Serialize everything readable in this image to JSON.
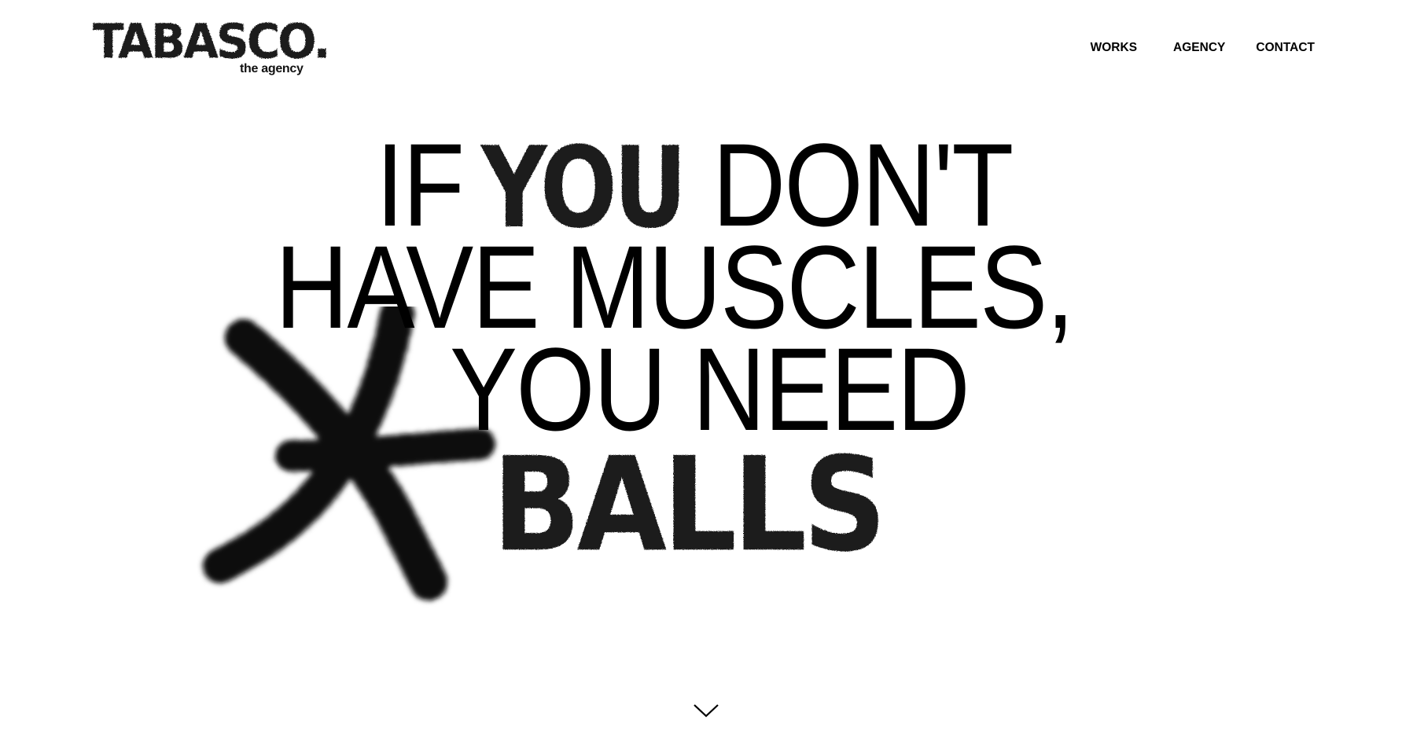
{
  "brand": {
    "name": "TABASCO.",
    "tagline": "the agency"
  },
  "nav": {
    "items": [
      {
        "label": "WORKS"
      },
      {
        "label": "AGENCY"
      },
      {
        "label": "CONTACT"
      }
    ]
  },
  "hero": {
    "line1_before": "IF",
    "line1_emphasis": "YOU",
    "line1_after": "DON'T",
    "line2": "HAVE MUSCLES,",
    "line3": "YOU NEED",
    "line4": "BALLS",
    "graffiti_mark_icon": "spray-paint-x-icon"
  },
  "scroll": {
    "icon": "chevron-down-icon"
  },
  "colors": {
    "background": "#ffffff",
    "text": "#000000"
  }
}
